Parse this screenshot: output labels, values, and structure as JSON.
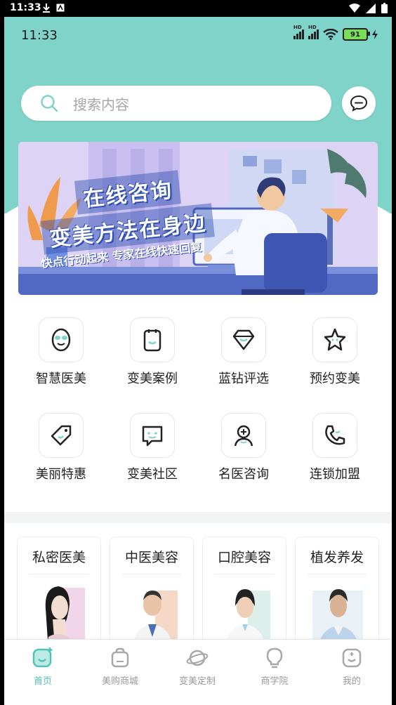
{
  "system_status": {
    "time": "11:33"
  },
  "app_status": {
    "time": "11:33",
    "signal_label_1": "HD",
    "signal_label_2": "HD",
    "battery": "91"
  },
  "search": {
    "placeholder": "搜索内容"
  },
  "banner": {
    "title_line1": "在线咨询",
    "title_line2": "变美方法在身边",
    "subtitle": "快点行动起来 专家在线快速回复"
  },
  "services": [
    {
      "label": "智慧医美",
      "icon": "face-scan-icon"
    },
    {
      "label": "变美案例",
      "icon": "clipboard-face-icon"
    },
    {
      "label": "蓝钻评选",
      "icon": "diamond-face-icon"
    },
    {
      "label": "预约变美",
      "icon": "star-face-icon"
    },
    {
      "label": "美丽特惠",
      "icon": "tag-face-icon"
    },
    {
      "label": "变美社区",
      "icon": "chat-bubble-face-icon"
    },
    {
      "label": "名医咨询",
      "icon": "doctor-icon"
    },
    {
      "label": "连锁加盟",
      "icon": "phone-face-icon"
    }
  ],
  "categories": [
    {
      "title": "私密医美"
    },
    {
      "title": "中医美容"
    },
    {
      "title": "口腔美容"
    },
    {
      "title": "植发养发"
    }
  ],
  "tabbar": {
    "items": [
      {
        "label": "首页",
        "icon": "home-icon",
        "active": true
      },
      {
        "label": "美购商城",
        "icon": "shopping-bag-icon",
        "active": false
      },
      {
        "label": "变美定制",
        "icon": "planet-icon",
        "active": false
      },
      {
        "label": "商学院",
        "icon": "lightbulb-icon",
        "active": false
      },
      {
        "label": "我的",
        "icon": "profile-icon",
        "active": false
      }
    ]
  },
  "colors": {
    "accent": "#7fd3c8",
    "active_tab": "#4fc3b7"
  }
}
